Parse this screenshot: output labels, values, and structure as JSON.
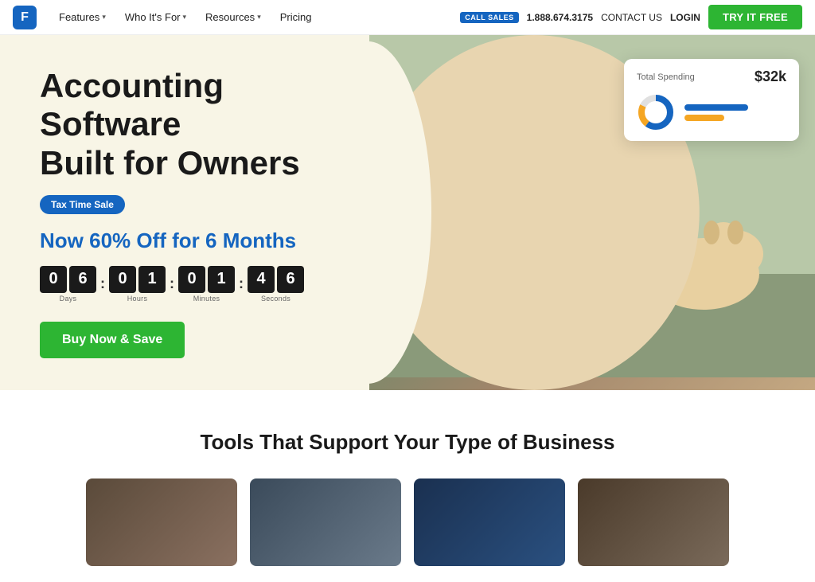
{
  "nav": {
    "logo_letter": "F",
    "links": [
      {
        "label": "Features",
        "has_dropdown": true
      },
      {
        "label": "Who It's For",
        "has_dropdown": true
      },
      {
        "label": "Resources",
        "has_dropdown": true
      },
      {
        "label": "Pricing",
        "has_dropdown": false
      }
    ],
    "call_sales": "CALL SALES",
    "phone": "1.888.674.3175",
    "contact": "CONTACT US",
    "login": "LOGIN",
    "try_free": "TRY IT FREE"
  },
  "hero": {
    "heading_line1": "Accounting Software",
    "heading_line2": "Built for Owners",
    "badge": "Tax Time Sale",
    "discount": "Now 60% Off for 6 Months",
    "countdown": {
      "days_1": "0",
      "days_2": "6",
      "hours_1": "0",
      "hours_2": "1",
      "minutes_1": "0",
      "minutes_2": "1",
      "seconds_1": "4",
      "seconds_2": "6",
      "label_days": "Days",
      "label_hours": "Hours",
      "label_minutes": "Minutes",
      "label_seconds": "Seconds"
    },
    "buy_button": "Buy Now & Save"
  },
  "spending_widget": {
    "title": "Total Spending",
    "amount": "$32k"
  },
  "tools_section": {
    "heading": "Tools That Support Your Type of Business"
  },
  "colors": {
    "blue": "#1565c0",
    "green": "#2db533",
    "hero_bg": "#f8f5e6"
  }
}
